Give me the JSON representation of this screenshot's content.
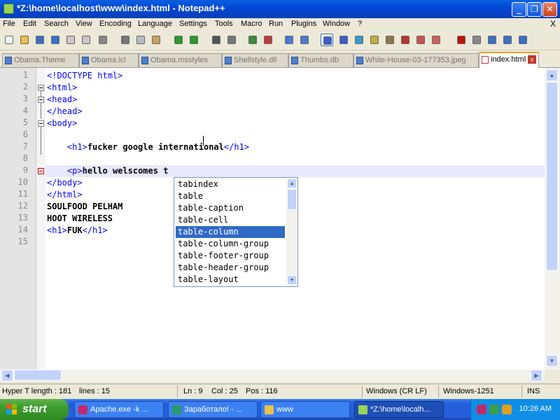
{
  "window": {
    "title": "*Z:\\home\\localhost\\www\\index.html - Notepad++",
    "minimize": "_",
    "maximize": "❐",
    "close": "✕"
  },
  "menu": [
    "File",
    "Edit",
    "Search",
    "View",
    "Encoding",
    "Language",
    "Settings",
    "Tools",
    "Macro",
    "Run",
    "Plugins",
    "Window",
    "?"
  ],
  "menu_close": "X",
  "toolbar_icons": [
    "new-file-icon",
    "open-file-icon",
    "save-icon",
    "save-all-icon",
    "close-icon",
    "close-all-icon",
    "print-icon",
    "cut-icon",
    "copy-icon",
    "paste-icon",
    "undo-icon",
    "redo-icon",
    "find-icon",
    "replace-icon",
    "zoom-in-icon",
    "zoom-out-icon",
    "sync-vertical-icon",
    "sync-horizontal-icon",
    "word-wrap-icon",
    "show-all-chars-icon",
    "indent-guide-icon",
    "user-lang-icon",
    "doc-map-icon",
    "function-list-icon",
    "folder-workspace-icon",
    "monitor-icon",
    "record-macro-icon",
    "stop-record-icon",
    "play-macro-icon",
    "run-macro-multiple-icon",
    "save-macro-icon"
  ],
  "tabs": [
    {
      "label": "Obama.Theme",
      "active": false
    },
    {
      "label": "Obama.icl",
      "active": false
    },
    {
      "label": "Obama.msstyles",
      "active": false
    },
    {
      "label": "Shellstyle.dll",
      "active": false
    },
    {
      "label": "Thumbs.db",
      "active": false
    },
    {
      "label": "White-House-03-177353.jpeg",
      "active": false
    },
    {
      "label": "index.html",
      "active": true
    }
  ],
  "tab_close": "x",
  "lines": [
    {
      "n": "1",
      "parts": [
        [
          "doctype",
          "<!DOCTYPE html>"
        ]
      ]
    },
    {
      "n": "2",
      "parts": [
        [
          "tag",
          "<html>"
        ]
      ]
    },
    {
      "n": "3",
      "parts": [
        [
          "tag",
          "<head>"
        ]
      ]
    },
    {
      "n": "4",
      "parts": [
        [
          "tag",
          "</head>"
        ]
      ]
    },
    {
      "n": "5",
      "parts": [
        [
          "tag",
          "<body>"
        ]
      ]
    },
    {
      "n": "6",
      "parts": [
        [
          "txt",
          ""
        ]
      ]
    },
    {
      "n": "7",
      "parts": [
        [
          "txt",
          "    "
        ],
        [
          "tag",
          "<h1>"
        ],
        [
          "txt",
          "fucker google international"
        ],
        [
          "tag",
          "</h1>"
        ]
      ]
    },
    {
      "n": "8",
      "parts": [
        [
          "txt",
          ""
        ]
      ]
    },
    {
      "n": "9",
      "parts": [
        [
          "txt",
          "    "
        ],
        [
          "tag",
          "<p>"
        ],
        [
          "txt",
          "hello welscomes t"
        ]
      ]
    },
    {
      "n": "10",
      "parts": [
        [
          "tag",
          "</body>"
        ]
      ]
    },
    {
      "n": "11",
      "parts": [
        [
          "tag",
          "</html>"
        ]
      ]
    },
    {
      "n": "12",
      "parts": [
        [
          "txt",
          "SOULFOOD PELHAM"
        ]
      ]
    },
    {
      "n": "13",
      "parts": [
        [
          "txt",
          "HOOT WIRELESS"
        ]
      ]
    },
    {
      "n": "14",
      "parts": [
        [
          "tag",
          "<h1>"
        ],
        [
          "txt",
          "FUK"
        ],
        [
          "tag",
          "</h1>"
        ]
      ]
    },
    {
      "n": "15",
      "parts": [
        [
          "txt",
          ""
        ]
      ]
    }
  ],
  "autocomplete": {
    "items": [
      "tabindex",
      "table",
      "table-caption",
      "table-cell",
      "table-column",
      "table-column-group",
      "table-footer-group",
      "table-header-group",
      "table-layout"
    ],
    "selected": "table-column"
  },
  "status": {
    "lang": "Hyper T length : 181",
    "lines": "lines : 15",
    "ln": "Ln : 9",
    "col": "Col : 25",
    "pos": "Pos : 116",
    "eol": "Windows (CR LF)",
    "encoding": "Windows-1251",
    "mode": "INS"
  },
  "taskbar": {
    "start_label": "start",
    "tasks": [
      {
        "label": "Apache.exe -k ...",
        "active": false,
        "icon_color": "#c02a6a"
      },
      {
        "label": "Заработало! - ...",
        "active": false,
        "icon_color": "#2a9a6a"
      },
      {
        "label": "www",
        "active": false,
        "icon_color": "#e8c24a"
      },
      {
        "label": "*Z:\\home\\localh...",
        "active": true,
        "icon_color": "#9bd35a"
      }
    ],
    "clock": "10:26 AM"
  }
}
